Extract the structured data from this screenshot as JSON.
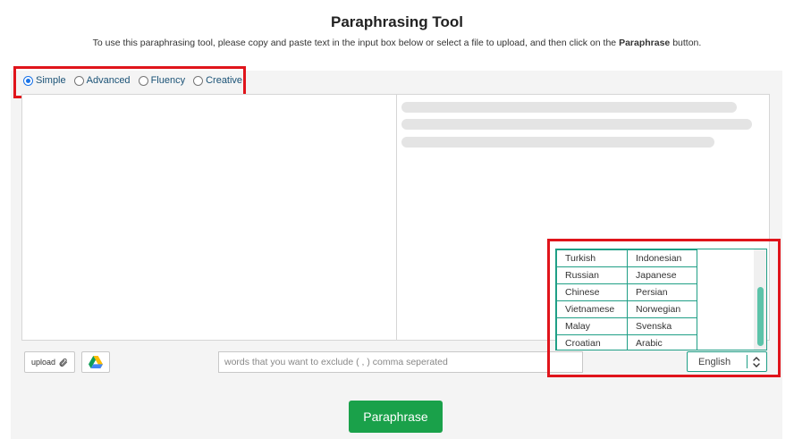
{
  "header": {
    "title": "Paraphrasing Tool",
    "subtitle_prefix": "To use this paraphrasing tool, please copy and paste text in the input box below or select a file to upload, and then click on the",
    "subtitle_bold": "Paraphrase",
    "subtitle_suffix": "button."
  },
  "modes": {
    "selected": "Simple",
    "options": [
      "Simple",
      "Advanced",
      "Fluency",
      "Creative"
    ]
  },
  "toolbar": {
    "upload_label": "upload",
    "exclude_placeholder": "words that you want to exclude ( , ) comma seperated"
  },
  "language": {
    "selected": "English",
    "options": [
      [
        "Turkish",
        "Indonesian"
      ],
      [
        "Russian",
        "Japanese"
      ],
      [
        "Chinese",
        "Persian"
      ],
      [
        "Vietnamese",
        "Norwegian"
      ],
      [
        "Malay",
        "Svenska"
      ],
      [
        "Croatian",
        "Arabic"
      ]
    ]
  },
  "actions": {
    "paraphrase_label": "Paraphrase"
  },
  "colors": {
    "accent_green": "#1aa14a",
    "teal_border": "#1f9f86",
    "highlight_red": "#e0141b",
    "mode_text": "#1a5276"
  },
  "icons": {
    "upload": "paperclip-icon",
    "drive": "google-drive-icon",
    "select": "chevron-up-down-icon"
  }
}
